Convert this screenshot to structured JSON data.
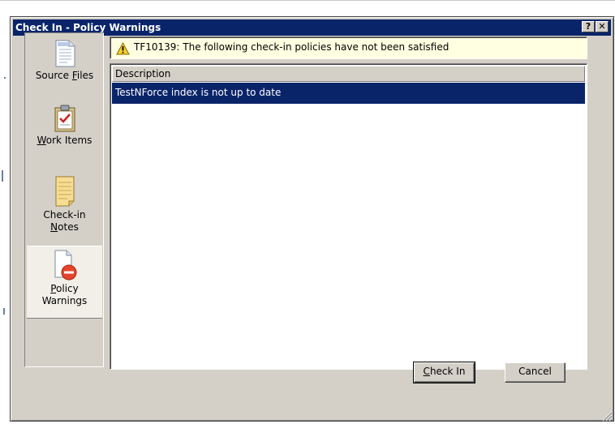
{
  "window": {
    "title": "Check In - Policy Warnings",
    "help_button": "?",
    "close_button": "✕"
  },
  "sidebar": {
    "items": [
      {
        "label_pre": "Source ",
        "label_acc": "F",
        "label_post": "iles",
        "icon": "source-files-icon"
      },
      {
        "label_pre": "",
        "label_acc": "W",
        "label_post": "ork Items",
        "icon": "work-items-icon"
      },
      {
        "line1": "Check-in",
        "label_acc": "N",
        "label_post": "otes",
        "icon": "checkin-notes-icon"
      },
      {
        "label_acc": "P",
        "label_post": "olicy",
        "line2": "Warnings",
        "icon": "policy-warnings-icon",
        "selected": true
      }
    ]
  },
  "warning": {
    "message": "TF10139: The following check-in policies have not been satisfied",
    "icon": "warning-icon"
  },
  "list": {
    "column_header": "Description",
    "rows": [
      "TestNForce index is not up to date"
    ]
  },
  "buttons": {
    "checkin_acc": "C",
    "checkin_rest": "heck In",
    "cancel": "Cancel"
  },
  "colors": {
    "titlebar": "#0a246a",
    "dialog_bg": "#d4d0c8",
    "selection": "#0a246a",
    "warning_bg": "#ffffe1"
  }
}
